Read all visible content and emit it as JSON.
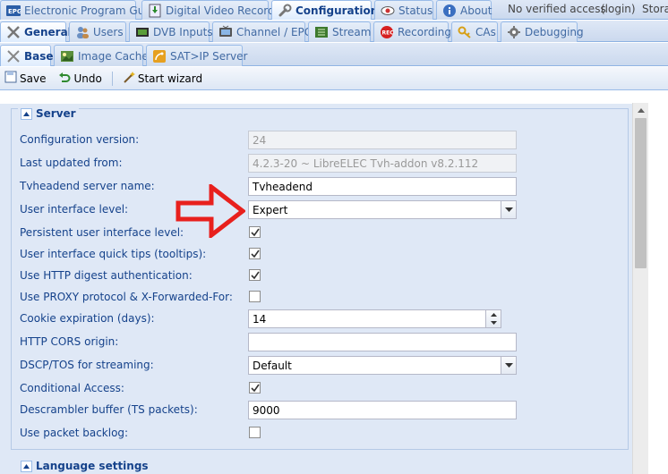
{
  "main_tabs": [
    {
      "label": "Electronic Program Guide",
      "icon": "epg-icon"
    },
    {
      "label": "Digital Video Recorder",
      "icon": "dvr-icon"
    },
    {
      "label": "Configuration",
      "icon": "wrench-icon",
      "active": true
    },
    {
      "label": "Status",
      "icon": "eye-icon"
    },
    {
      "label": "About",
      "icon": "info-icon"
    }
  ],
  "access_text": "No verified access",
  "login_link": "(login)",
  "storage_text": "Storag",
  "config_tabs": [
    {
      "label": "General",
      "icon": "tools-icon",
      "active": true
    },
    {
      "label": "Users",
      "icon": "users-icon"
    },
    {
      "label": "DVB Inputs",
      "icon": "dvb-icon"
    },
    {
      "label": "Channel / EPG",
      "icon": "tv-icon"
    },
    {
      "label": "Stream",
      "icon": "stream-icon"
    },
    {
      "label": "Recording",
      "icon": "rec-icon"
    },
    {
      "label": "CAs",
      "icon": "key-icon"
    },
    {
      "label": "Debugging",
      "icon": "gear-icon"
    }
  ],
  "general_tabs": [
    {
      "label": "Base",
      "icon": "base-icon",
      "active": true
    },
    {
      "label": "Image Cache",
      "icon": "image-icon"
    },
    {
      "label": "SAT>IP Server",
      "icon": "satip-icon"
    }
  ],
  "toolbar": {
    "save": "Save",
    "undo": "Undo",
    "wizard": "Start wizard"
  },
  "server_section": {
    "title": "Server",
    "fields": {
      "config_version": {
        "label": "Configuration version:",
        "value": "24"
      },
      "last_updated": {
        "label": "Last updated from:",
        "value": "4.2.3-20 ~ LibreELEC Tvh-addon v8.2.112"
      },
      "server_name": {
        "label": "Tvheadend server name:",
        "value": "Tvheadend"
      },
      "ui_level": {
        "label": "User interface level:",
        "value": "Expert"
      },
      "persistent_ui": {
        "label": "Persistent user interface level:",
        "checked": true
      },
      "quick_tips": {
        "label": "User interface quick tips (tooltips):",
        "checked": true
      },
      "http_digest": {
        "label": "Use HTTP digest authentication:",
        "checked": true
      },
      "proxy_protocol": {
        "label": "Use PROXY protocol & X-Forwarded-For:",
        "checked": false
      },
      "cookie_expiration": {
        "label": "Cookie expiration (days):",
        "value": "14"
      },
      "cors_origin": {
        "label": "HTTP CORS origin:",
        "value": ""
      },
      "dscp_tos": {
        "label": "DSCP/TOS for streaming:",
        "value": "Default"
      },
      "conditional_access": {
        "label": "Conditional Access:",
        "checked": true
      },
      "descrambler_buffer": {
        "label": "Descrambler buffer (TS packets):",
        "value": "9000"
      },
      "packet_backlog": {
        "label": "Use packet backlog:",
        "checked": false
      }
    }
  },
  "language_section": {
    "title": "Language settings"
  },
  "colors": {
    "accent": "#15428b",
    "panel": "#dfe8f6",
    "annotation_arrow": "#e8201d"
  }
}
